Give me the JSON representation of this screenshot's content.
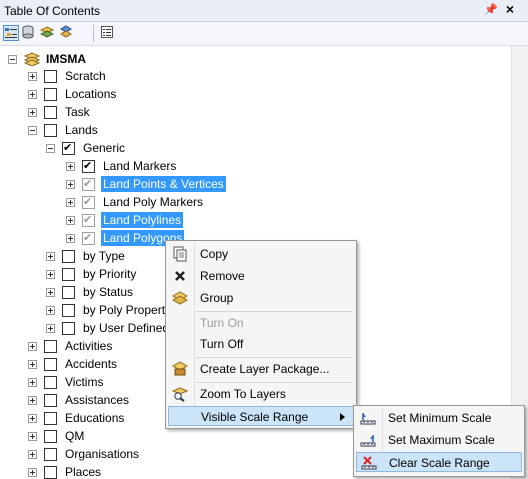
{
  "window": {
    "title": "Table Of Contents",
    "pin_glyph": "ᆓ",
    "close_glyph": "×"
  },
  "toolbar": {
    "buttons": [
      "list-by-drawing-order-icon",
      "list-by-source-icon",
      "list-by-visibility-icon",
      "list-by-selection-icon",
      "options-icon"
    ]
  },
  "tree": {
    "root": "IMSMA",
    "items": [
      {
        "label": "Scratch",
        "checked": false
      },
      {
        "label": "Locations",
        "checked": false
      },
      {
        "label": "Task",
        "checked": false
      },
      {
        "label": "Lands",
        "checked": false,
        "expanded": true
      },
      {
        "label": "Generic",
        "checked": true,
        "expanded": true
      },
      {
        "label": "Land Markers",
        "checked": true
      },
      {
        "label": "Land Points & Vertices",
        "checked": true,
        "selected": true
      },
      {
        "label": "Land Poly Markers",
        "checked": true
      },
      {
        "label": "Land Polylines",
        "checked": true,
        "selected": true
      },
      {
        "label": "Land Polygons",
        "checked": true,
        "selected": true
      },
      {
        "label": "by Type",
        "checked": false
      },
      {
        "label": "by Priority",
        "checked": false
      },
      {
        "label": "by Status",
        "checked": false
      },
      {
        "label": "by Poly Propert",
        "checked": false
      },
      {
        "label": "by User Defined",
        "checked": false
      },
      {
        "label": "Activities",
        "checked": false
      },
      {
        "label": "Accidents",
        "checked": false
      },
      {
        "label": "Victims",
        "checked": false
      },
      {
        "label": "Assistances",
        "checked": false
      },
      {
        "label": "Educations",
        "checked": false
      },
      {
        "label": "QM",
        "checked": false
      },
      {
        "label": "Organisations",
        "checked": false
      },
      {
        "label": "Places",
        "checked": false
      }
    ]
  },
  "context_menu": {
    "items": [
      {
        "label": "Copy",
        "icon": "copy-icon"
      },
      {
        "label": "Remove",
        "icon": "remove-x-icon"
      },
      {
        "label": "Group",
        "icon": "group-layers-icon"
      },
      {
        "label": "Turn On",
        "disabled": true
      },
      {
        "label": "Turn Off"
      },
      {
        "label": "Create Layer Package...",
        "icon": "layer-package-icon"
      },
      {
        "label": "Zoom To Layers",
        "icon": "zoom-to-layers-icon"
      },
      {
        "label": "Visible Scale Range",
        "submenu": true,
        "highlighted": true
      }
    ]
  },
  "submenu": {
    "items": [
      {
        "label": "Set Minimum Scale",
        "icon": "set-minimum-scale-icon"
      },
      {
        "label": "Set Maximum Scale",
        "icon": "set-maximum-scale-icon"
      },
      {
        "label": "Clear Scale Range",
        "icon": "clear-scale-range-icon",
        "highlighted": true
      }
    ]
  },
  "colors": {
    "selection": "#3399ff",
    "menu_highlight": "#cce4f7",
    "menu_bg": "#f5f5f5"
  }
}
